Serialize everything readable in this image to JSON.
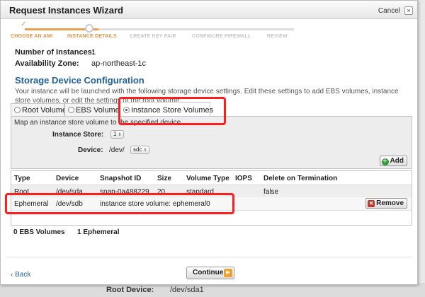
{
  "dialog": {
    "title": "Request Instances Wizard",
    "cancel_label": "Cancel",
    "close_glyph": "×"
  },
  "steps": [
    {
      "label": "CHOOSE AN AMI",
      "state": "done"
    },
    {
      "label": "INSTANCE DETAILS",
      "state": "current"
    },
    {
      "label": "CREATE KEY PAIR",
      "state": "todo"
    },
    {
      "label": "CONFIGURE FIREWALL",
      "state": "todo"
    },
    {
      "label": "REVIEW",
      "state": "todo"
    }
  ],
  "details": {
    "instances_label": "Number of Instances:",
    "instances_value": "1",
    "zone_label": "Availability Zone:",
    "zone_value": "ap-northeast-1c"
  },
  "storage": {
    "title": "Storage Device Configuration",
    "description": "Your instance will be launched with the following storage device settings. Edit these settings to add EBS volumes, instance store volumes, or edit the settings of the root volume."
  },
  "tabs": [
    {
      "label": "Root Volume",
      "selected": false
    },
    {
      "label": "EBS Volumes",
      "selected": false
    },
    {
      "label": "Instance Store Volumes",
      "selected": true
    }
  ],
  "panel": {
    "description": "Map an instance store volume to the specified device.",
    "instance_store_label": "Instance Store:",
    "instance_store_value": "1",
    "device_label": "Device:",
    "device_prefix": "/dev/",
    "device_value": "sdc",
    "add_label": "Add"
  },
  "table": {
    "headers": [
      "Type",
      "Device",
      "Snapshot ID",
      "Size",
      "Volume Type",
      "IOPS",
      "Delete on Termination"
    ],
    "rows": [
      {
        "type": "Root",
        "device": "/dev/sda",
        "snapshot": "snap-0a488229",
        "size": "20",
        "volume_type": "standard",
        "iops": "",
        "delete": "false"
      },
      {
        "type": "Ephemeral",
        "device": "/dev/sdb",
        "snapshot": "instance store volume: ephemeral0",
        "size": "",
        "volume_type": "",
        "iops": "",
        "delete": ""
      }
    ],
    "remove_label": "Remove"
  },
  "summary": {
    "ebs": "0 EBS Volumes",
    "ephemeral": "1 Ephemeral"
  },
  "footer": {
    "back_label": "Back",
    "back_glyph": "‹",
    "continue_label": "Continue"
  },
  "background": {
    "root_device_label": "Root Device:",
    "root_device_value": "/dev/sda1"
  },
  "colors": {
    "highlight": "#ff1e1e",
    "step_done": "#e39240",
    "link": "#1f5f9e"
  }
}
